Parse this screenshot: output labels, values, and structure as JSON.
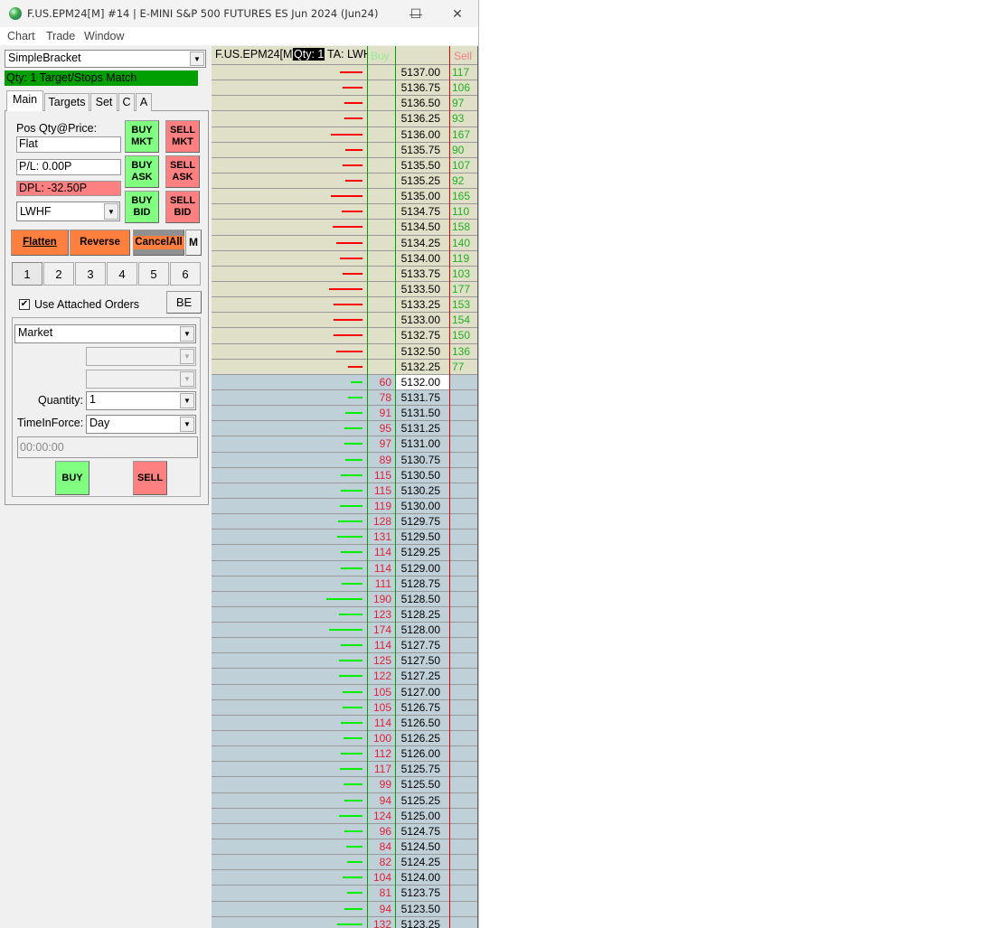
{
  "window": {
    "title": "F.US.EPM24[M] #14 | E-MINI S&P 500 FUTURES ES Jun 2024 (Jun24)",
    "minimize": "—",
    "maximize": "☐",
    "close": "✕"
  },
  "menu": [
    "Chart",
    "Trade",
    "Window"
  ],
  "panel": {
    "strategy": "SimpleBracket",
    "status": "Qty: 1 Target/Stops Match",
    "status_color": "#00a000",
    "tabs": [
      "Main",
      "Targets",
      "Set",
      "C",
      "A"
    ],
    "pos_label": "Pos Qty@Price:",
    "pos_value": "Flat",
    "pl": "P/L: 0.00P",
    "dpl": "DPL: -32.50P",
    "account": "LWHF",
    "buy_mkt": "BUY MKT",
    "sell_mkt": "SELL MKT",
    "buy_ask": "BUY ASK",
    "sell_ask": "SELL ASK",
    "buy_bid": "BUY BID",
    "sell_bid": "SELL BID",
    "flatten": "Flatten",
    "reverse": "Reverse",
    "cancel_all": "CancelAll",
    "m": "M",
    "numbers": [
      "1",
      "2",
      "3",
      "4",
      "5",
      "6"
    ],
    "use_attached": "Use Attached Orders",
    "use_attached_checked": true,
    "be": "BE",
    "order_type": "Market",
    "quantity_label": "Quantity:",
    "quantity": "1",
    "tif_label": "TimeInForce:",
    "tif": "Day",
    "time": "00:00:00",
    "buy": "BUY",
    "sell": "SELL"
  },
  "ladder": {
    "symbol": "F.US.EPM24[M]",
    "qty": "Qty: 1",
    "ta": "TA: LWH",
    "buy_header": "Buy",
    "sell_header": "Sell",
    "ask_color": "#ff0000",
    "bid_color": "#00ee00",
    "asks": [
      [
        "5137.00",
        "117"
      ],
      [
        "5136.75",
        "106"
      ],
      [
        "5136.50",
        "97"
      ],
      [
        "5136.25",
        "93"
      ],
      [
        "5136.00",
        "167"
      ],
      [
        "5135.75",
        "90"
      ],
      [
        "5135.50",
        "107"
      ],
      [
        "5135.25",
        "92"
      ],
      [
        "5135.00",
        "165"
      ],
      [
        "5134.75",
        "110"
      ],
      [
        "5134.50",
        "158"
      ],
      [
        "5134.25",
        "140"
      ],
      [
        "5134.00",
        "119"
      ],
      [
        "5133.75",
        "103"
      ],
      [
        "5133.50",
        "177"
      ],
      [
        "5133.25",
        "153"
      ],
      [
        "5133.00",
        "154"
      ],
      [
        "5132.75",
        "150"
      ],
      [
        "5132.50",
        "136"
      ],
      [
        "5132.25",
        "77"
      ]
    ],
    "bids": [
      [
        "5132.00",
        "60"
      ],
      [
        "5131.75",
        "78"
      ],
      [
        "5131.50",
        "91"
      ],
      [
        "5131.25",
        "95"
      ],
      [
        "5131.00",
        "97"
      ],
      [
        "5130.75",
        "89"
      ],
      [
        "5130.50",
        "115"
      ],
      [
        "5130.25",
        "115"
      ],
      [
        "5130.00",
        "119"
      ],
      [
        "5129.75",
        "128"
      ],
      [
        "5129.50",
        "131"
      ],
      [
        "5129.25",
        "114"
      ],
      [
        "5129.00",
        "114"
      ],
      [
        "5128.75",
        "111"
      ],
      [
        "5128.50",
        "190"
      ],
      [
        "5128.25",
        "123"
      ],
      [
        "5128.00",
        "174"
      ],
      [
        "5127.75",
        "114"
      ],
      [
        "5127.50",
        "125"
      ],
      [
        "5127.25",
        "122"
      ],
      [
        "5127.00",
        "105"
      ],
      [
        "5126.75",
        "105"
      ],
      [
        "5126.50",
        "114"
      ],
      [
        "5126.25",
        "100"
      ],
      [
        "5126.00",
        "112"
      ],
      [
        "5125.75",
        "117"
      ],
      [
        "5125.50",
        "99"
      ],
      [
        "5125.25",
        "94"
      ],
      [
        "5125.00",
        "124"
      ],
      [
        "5124.75",
        "96"
      ],
      [
        "5124.50",
        "84"
      ],
      [
        "5124.25",
        "82"
      ],
      [
        "5124.00",
        "104"
      ],
      [
        "5123.75",
        "81"
      ],
      [
        "5123.50",
        "94"
      ],
      [
        "5123.25",
        "132"
      ]
    ]
  }
}
